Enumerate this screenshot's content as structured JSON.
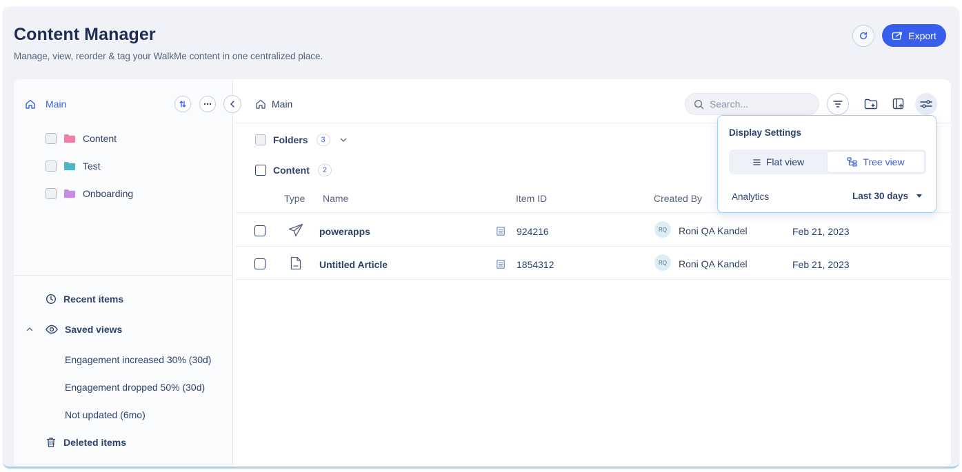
{
  "header": {
    "title": "Content Manager",
    "subtitle": "Manage, view, reorder & tag your WalkMe content in one centralized place.",
    "export_label": "Export"
  },
  "sidebar": {
    "root_label": "Main",
    "folders": [
      {
        "label": "Content",
        "color": "#f17fa5"
      },
      {
        "label": "Test",
        "color": "#4bb7c4"
      },
      {
        "label": "Onboarding",
        "color": "#c98ae6"
      }
    ],
    "recent_label": "Recent items",
    "saved_views_label": "Saved views",
    "saved_views": [
      "Engagement increased 30% (30d)",
      "Engagement dropped 50% (30d)",
      "Not updated (6mo)"
    ],
    "deleted_label": "Deleted items"
  },
  "main": {
    "breadcrumb": "Main",
    "search_placeholder": "Search...",
    "groups": {
      "folders_label": "Folders",
      "folders_count": "3",
      "content_label": "Content",
      "content_count": "2"
    },
    "columns": [
      "Type",
      "Name",
      "Item ID",
      "Created By"
    ],
    "rows": [
      {
        "type_icon": "send-icon",
        "name": "powerapps",
        "item_id": "924216",
        "avatar": "RQ",
        "created_by": "Roni QA Kandel",
        "date": "Feb 21, 2023"
      },
      {
        "type_icon": "article-icon",
        "name": "Untitled Article",
        "item_id": "1854312",
        "avatar": "RQ",
        "created_by": "Roni QA Kandel",
        "date": "Feb 21, 2023"
      }
    ]
  },
  "display_settings": {
    "title": "Display Settings",
    "flat_view_label": "Flat view",
    "tree_view_label": "Tree view",
    "analytics_label": "Analytics",
    "analytics_value": "Last 30 days"
  },
  "colors": {
    "accent": "#385feb",
    "text": "#2f426c",
    "background": "#f0f2f8"
  }
}
